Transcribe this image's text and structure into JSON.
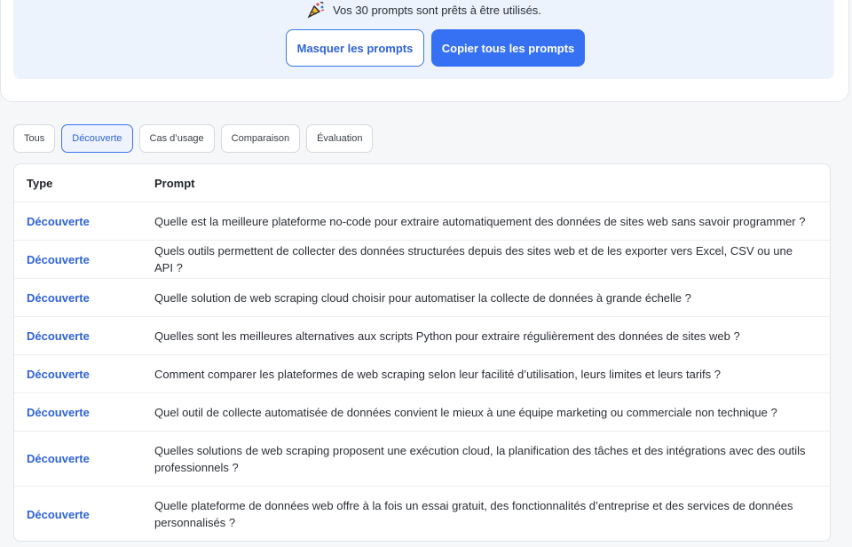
{
  "banner": {
    "icon": "party-popper-icon",
    "status_text": "Vos 30 prompts sont prêts à être utilisés.",
    "hide_button": "Masquer les prompts",
    "copy_button": "Copier tous les prompts"
  },
  "filters": [
    {
      "label": "Tous",
      "active": false
    },
    {
      "label": "Découverte",
      "active": true
    },
    {
      "label": "Cas d’usage",
      "active": false
    },
    {
      "label": "Comparaison",
      "active": false
    },
    {
      "label": "Évaluation",
      "active": false
    }
  ],
  "table": {
    "headers": {
      "type": "Type",
      "prompt": "Prompt"
    },
    "rows": [
      {
        "type": "Découverte",
        "prompt": "Quelle est la meilleure plateforme no-code pour extraire automatiquement des données de sites web sans savoir programmer ?"
      },
      {
        "type": "Découverte",
        "prompt": "Quels outils permettent de collecter des données structurées depuis des sites web et de les exporter vers Excel, CSV ou une API ?"
      },
      {
        "type": "Découverte",
        "prompt": "Quelle solution de web scraping cloud choisir pour automatiser la collecte de données à grande échelle ?"
      },
      {
        "type": "Découverte",
        "prompt": "Quelles sont les meilleures alternatives aux scripts Python pour extraire régulièrement des données de sites web ?"
      },
      {
        "type": "Découverte",
        "prompt": "Comment comparer les plateformes de web scraping selon leur facilité d’utilisation, leurs limites et leurs tarifs ?"
      },
      {
        "type": "Découverte",
        "prompt": "Quel outil de collecte automatisée de données convient le mieux à une équipe marketing ou commerciale non technique ?"
      },
      {
        "type": "Découverte",
        "prompt": "Quelles solutions de web scraping proposent une exécution cloud, la planification des tâches et des intégrations avec des outils professionnels ?"
      },
      {
        "type": "Découverte",
        "prompt": "Quelle plateforme de données web offre à la fois un essai gratuit, des fonctionnalités d’entreprise et des services de données personnalisés ?"
      }
    ]
  }
}
